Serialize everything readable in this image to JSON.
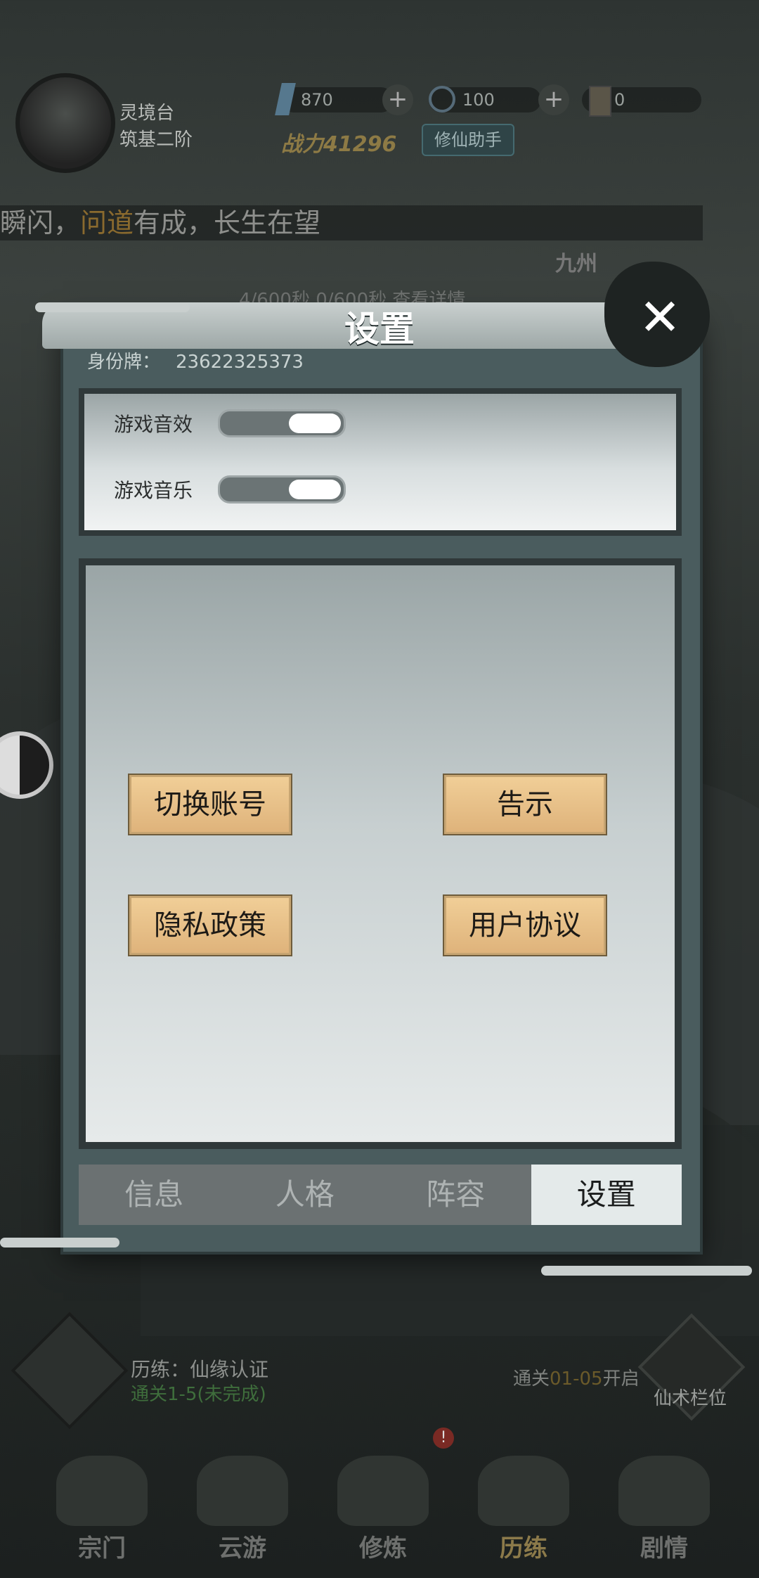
{
  "player": {
    "name": "灵境台",
    "rank": "筑基二阶"
  },
  "resources": {
    "crystal": "870",
    "stamina": "100",
    "tickets": "0"
  },
  "power": "战力41296",
  "assist_label": "修仙助手",
  "marquee": {
    "part1": "瞬闪，",
    "highlight": "问道",
    "part2": "有成，长生在望"
  },
  "jiuzhou_label": "九州",
  "bg_sub": "4/600秒    0/600秒    查看详情",
  "dialog": {
    "title": "设置",
    "id_label": "身份牌：",
    "id_value": "23622325373",
    "sound_label": "游戏音效",
    "music_label": "游戏音乐",
    "buttons": {
      "switch_account": "切换账号",
      "notice": "告示",
      "privacy": "隐私政策",
      "agreement": "用户协议"
    },
    "tabs": [
      "信息",
      "人格",
      "阵容",
      "设置"
    ],
    "active_tab": "设置"
  },
  "quest": {
    "title": "历练：仙缘认证",
    "sub": "通关1-5(未完成)",
    "open_prefix": "通关",
    "open_level": "01-05",
    "open_suffix": "开启"
  },
  "xian_label": "仙术栏位",
  "alert": "!",
  "nav": [
    "宗门",
    "云游",
    "修炼",
    "历练",
    "剧情"
  ],
  "nav_active": "历练",
  "colors": {
    "gold_button": "#deb27a",
    "dialog_bg": "#4a5c5e",
    "active_tab": "#e4eaea"
  }
}
